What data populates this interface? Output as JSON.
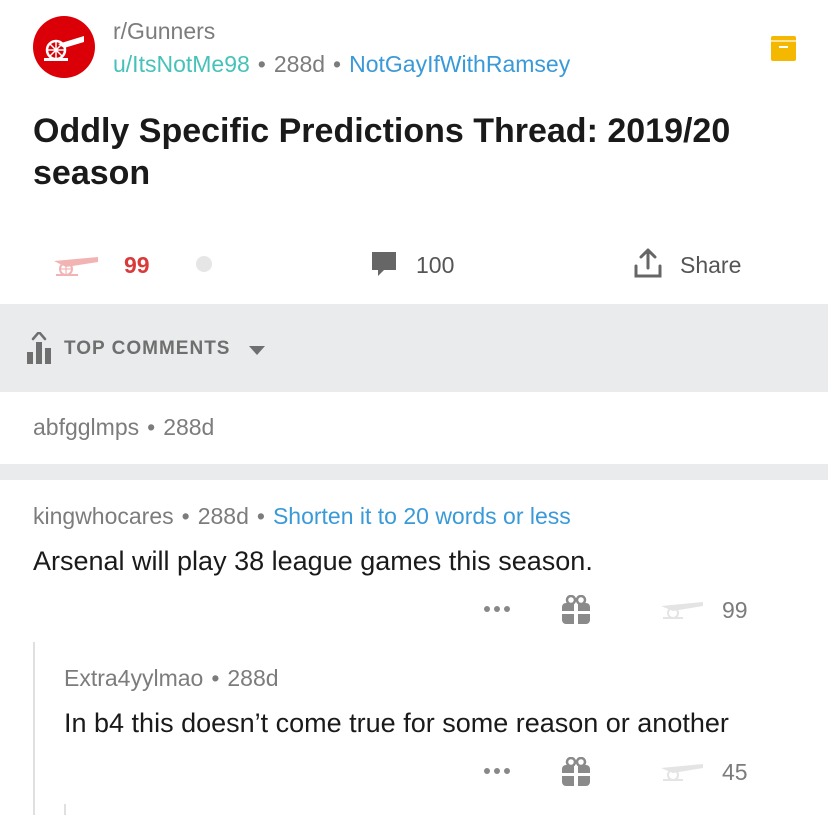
{
  "post": {
    "subreddit": "r/Gunners",
    "author": "u/ItsNotMe98",
    "age": "288d",
    "flair": "NotGayIfWithRamsey",
    "title": "Oddly Specific Predictions Thread: 2019/20 season",
    "score": "99",
    "comments": "100",
    "share_label": "Share"
  },
  "icons": {
    "subreddit_avatar": "arsenal-cannon-crest-icon",
    "save": "bookmark-icon",
    "upvote": "cannon-icon",
    "comment": "speech-bubble-icon",
    "share": "share-upload-icon",
    "sort": "bar-chart-sort-icon",
    "more": "ellipsis-icon",
    "gift": "gift-icon"
  },
  "sort": {
    "label": "TOP COMMENTS"
  },
  "comments": [
    {
      "author": "abfgglmps",
      "age": "288d",
      "collapsed": true
    },
    {
      "author": "kingwhocares",
      "age": "288d",
      "flair": "Shorten it to 20 words or less",
      "body": "Arsenal will play 38 league games this season.",
      "score": "99"
    },
    {
      "author": "Extra4yylmao",
      "age": "288d",
      "body": "In b4 this doesn’t come true for some reason or another",
      "score": "45"
    }
  ],
  "colors": {
    "subreddit_red": "#db0007",
    "username_teal": "#46c2b8",
    "flair_blue": "#3a9ad9",
    "vote_red": "#d93a3a",
    "save_yellow": "#f5b800",
    "band_gray": "#eaebec"
  }
}
